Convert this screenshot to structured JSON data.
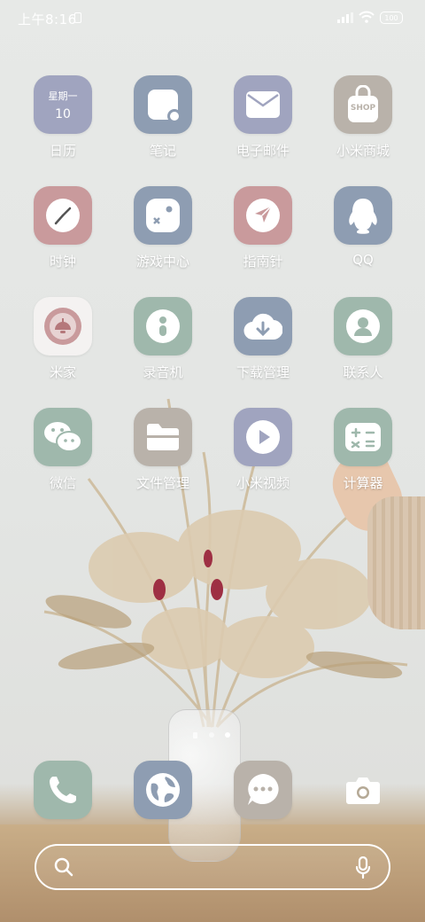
{
  "status_bar": {
    "time": "上午8:16",
    "battery": "100"
  },
  "apps": [
    {
      "name": "calendar",
      "label": "日历",
      "weekday": "星期一",
      "day": "10"
    },
    {
      "name": "notes",
      "label": "笔记"
    },
    {
      "name": "email",
      "label": "电子邮件"
    },
    {
      "name": "mi-store",
      "label": "小米商城",
      "badge_text": "SHOP"
    },
    {
      "name": "clock",
      "label": "时钟"
    },
    {
      "name": "game-center",
      "label": "游戏中心"
    },
    {
      "name": "compass",
      "label": "指南针"
    },
    {
      "name": "qq",
      "label": "QQ"
    },
    {
      "name": "mi-home",
      "label": "米家"
    },
    {
      "name": "recorder",
      "label": "录音机"
    },
    {
      "name": "downloads",
      "label": "下载管理"
    },
    {
      "name": "contacts",
      "label": "联系人"
    },
    {
      "name": "wechat",
      "label": "微信"
    },
    {
      "name": "file-manager",
      "label": "文件管理"
    },
    {
      "name": "mi-video",
      "label": "小米视频"
    },
    {
      "name": "calculator",
      "label": "计算器"
    }
  ],
  "page_indicator": {
    "total": 3,
    "current": 3
  },
  "dock": [
    "phone",
    "browser",
    "messages",
    "camera"
  ],
  "colors": {
    "lavender": "#a0a4bf",
    "slate_blue": "#8e9db2",
    "rose": "#c99a9c",
    "taupe": "#b9b2aa",
    "sage": "#9fb8ac",
    "white": "#f4f2f1"
  }
}
